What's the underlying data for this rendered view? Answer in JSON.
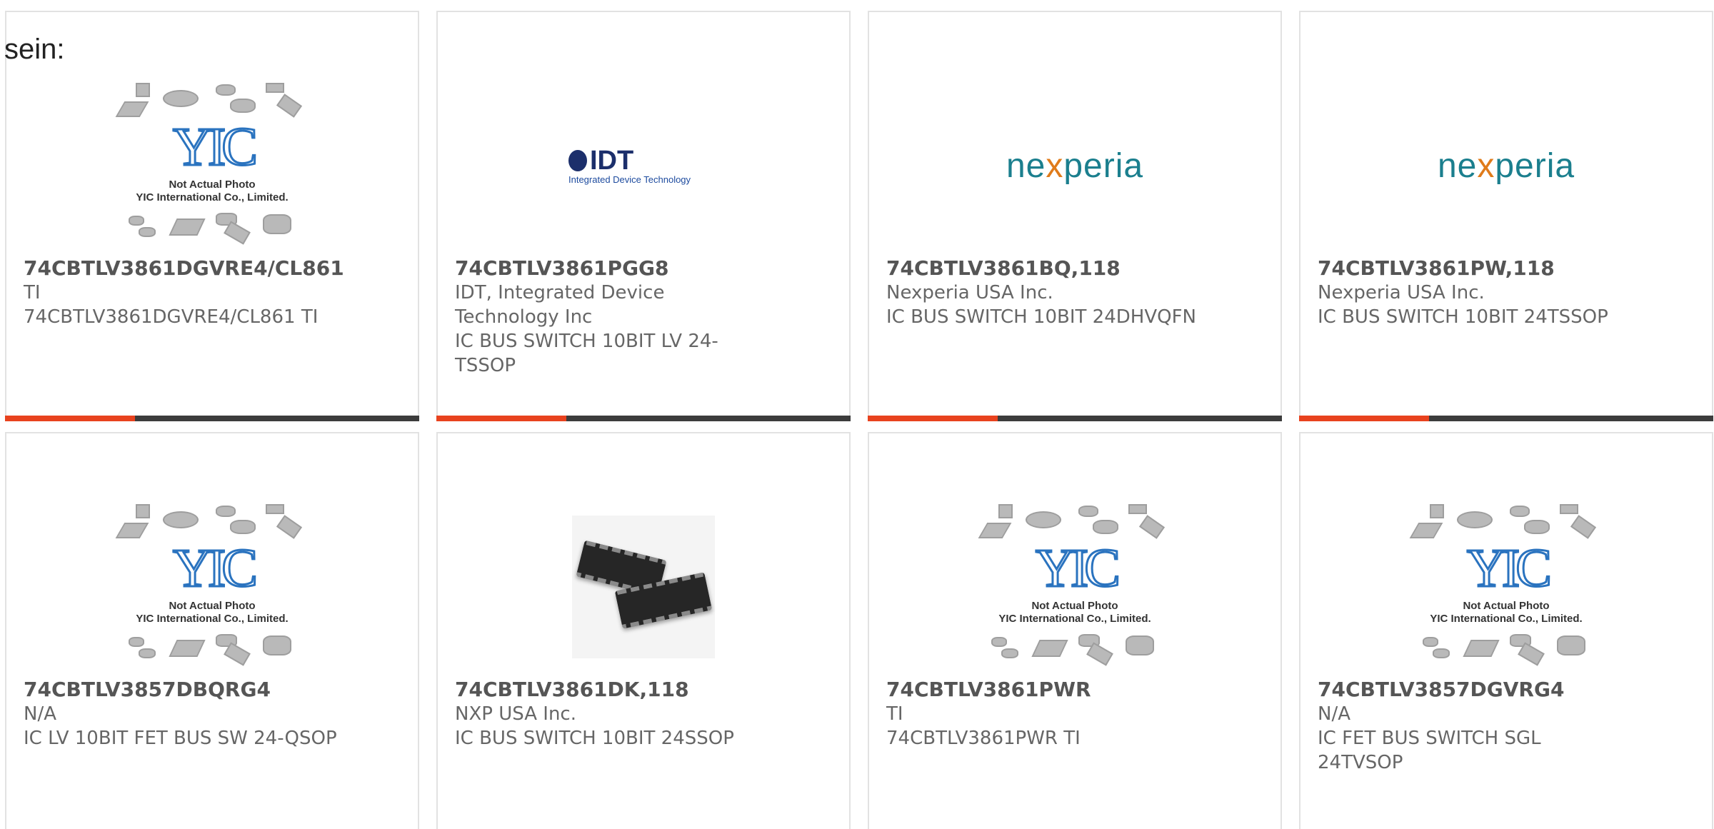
{
  "lead_text": "sein:",
  "placeholder": {
    "line1": "Not Actual Photo",
    "line2": "YIC International Co., Limited.",
    "logo": "YIC"
  },
  "brands": {
    "idt_mark": "IDT",
    "idt_sub": "Integrated Device Technology",
    "nexperia_a": "ne",
    "nexperia_x": "x",
    "nexperia_b": "peria"
  },
  "colors": {
    "accent": "#e8421e",
    "bar": "#3c3c3c",
    "border": "#e2e2e2"
  },
  "products": [
    {
      "part": "74CBTLV3861DGVRE4/CL861",
      "maker": "TI",
      "desc": "74CBTLV3861DGVRE4/CL861 TI",
      "image": "yic-placeholder"
    },
    {
      "part": "74CBTLV3861PGG8",
      "maker": "IDT, Integrated Device Technology Inc",
      "desc": "IC BUS SWITCH 10BIT LV 24-TSSOP",
      "image": "idt-logo"
    },
    {
      "part": "74CBTLV3861BQ,118",
      "maker": "Nexperia USA Inc.",
      "desc": "IC BUS SWITCH 10BIT 24DHVQFN",
      "image": "nexperia-logo"
    },
    {
      "part": "74CBTLV3861PW,118",
      "maker": "Nexperia USA Inc.",
      "desc": "IC BUS SWITCH 10BIT 24TSSOP",
      "image": "nexperia-logo"
    },
    {
      "part": "74CBTLV3857DBQRG4",
      "maker": "N/A",
      "desc": "IC LV 10BIT FET BUS SW 24-QSOP",
      "image": "yic-placeholder"
    },
    {
      "part": "74CBTLV3861DK,118",
      "maker": "NXP USA Inc.",
      "desc": "IC BUS SWITCH 10BIT 24SSOP",
      "image": "ic-photo"
    },
    {
      "part": "74CBTLV3861PWR",
      "maker": "TI",
      "desc": "74CBTLV3861PWR TI",
      "image": "yic-placeholder"
    },
    {
      "part": "74CBTLV3857DGVRG4",
      "maker": "N/A",
      "desc": "IC FET BUS SWITCH SGL 24TVSOP",
      "image": "yic-placeholder"
    }
  ]
}
